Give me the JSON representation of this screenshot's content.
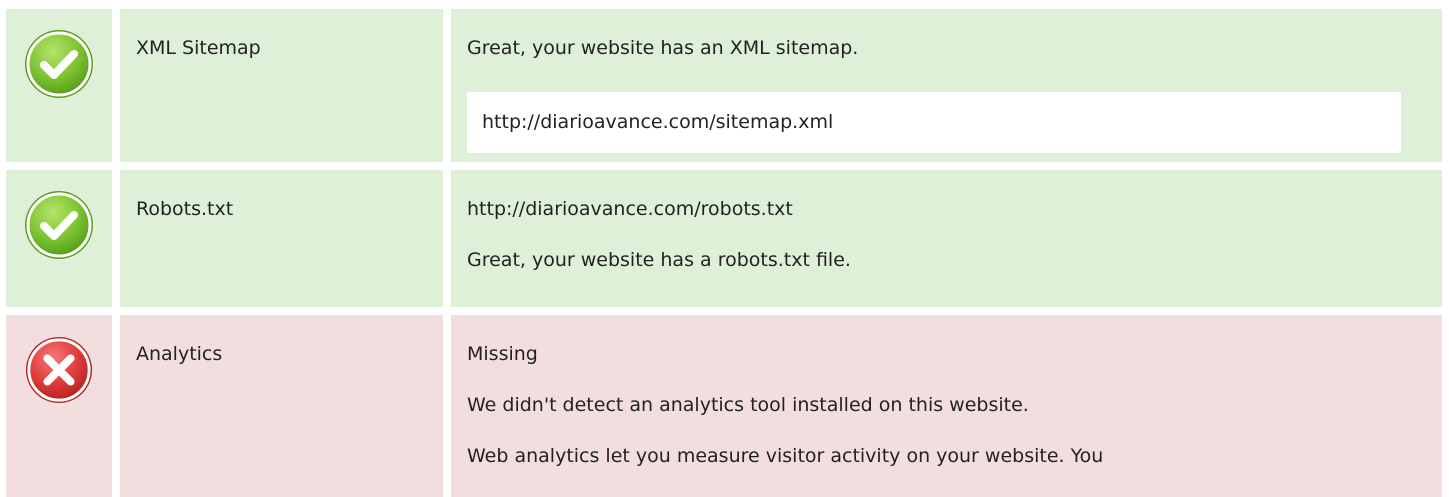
{
  "checks": [
    {
      "status": "pass",
      "icon": "check-icon",
      "label": "XML Sitemap",
      "lines": [
        "Great, your website has an XML sitemap."
      ],
      "url_box": "http://diarioavance.com/sitemap.xml"
    },
    {
      "status": "pass",
      "icon": "check-icon",
      "label": "Robots.txt",
      "lines": [
        "http://diarioavance.com/robots.txt",
        "Great, your website has a robots.txt file."
      ]
    },
    {
      "status": "fail",
      "icon": "error-icon",
      "label": "Analytics",
      "lines": [
        "Missing",
        "We didn't detect an analytics tool installed on this website.",
        "Web analytics let you measure visitor activity on your website. You"
      ]
    }
  ],
  "colors": {
    "pass_bg": "#dff0d8",
    "fail_bg": "#f2dede",
    "check_green": "#7bbf30",
    "error_red": "#d93b3b"
  }
}
